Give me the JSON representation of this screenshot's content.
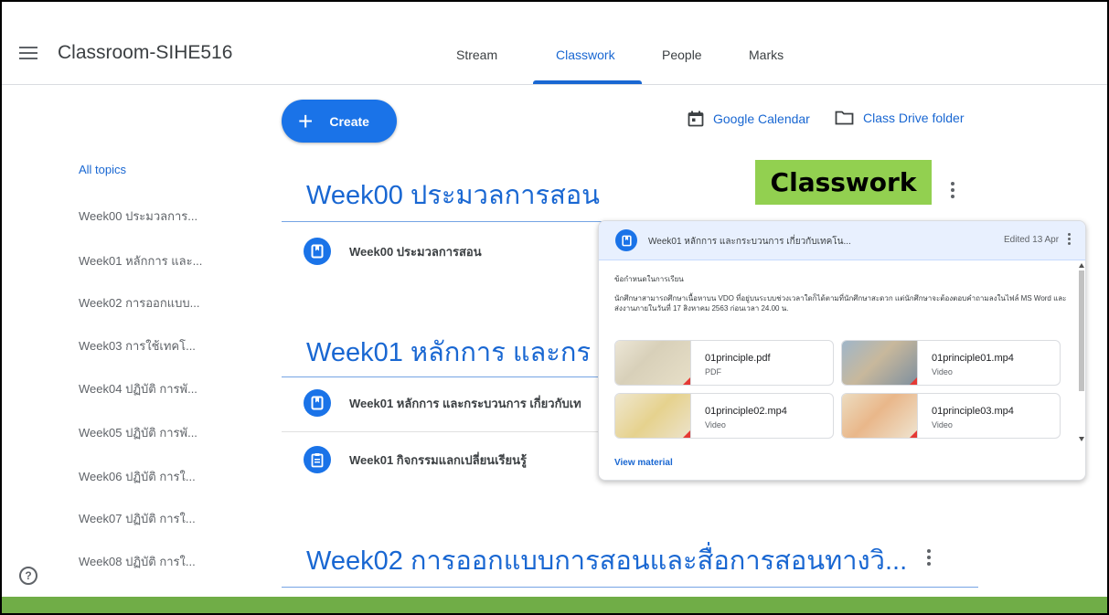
{
  "header": {
    "class_title": "Classroom-SIHE516",
    "tabs": [
      {
        "label": "Stream",
        "active": false
      },
      {
        "label": "Classwork",
        "active": true
      },
      {
        "label": "People",
        "active": false
      },
      {
        "label": "Marks",
        "active": false
      }
    ]
  },
  "toolbar": {
    "create_label": "Create",
    "calendar_label": "Google Calendar",
    "drive_label": "Class Drive folder"
  },
  "sidebar": {
    "topics": [
      {
        "label": "All topics",
        "active": true
      },
      {
        "label": "Week00 ประมวลการ..."
      },
      {
        "label": "Week01 หลักการ และ..."
      },
      {
        "label": "Week02 การออกแบบ..."
      },
      {
        "label": "Week03 การใช้เทคโ..."
      },
      {
        "label": "Week04 ปฏิบัติ การพั..."
      },
      {
        "label": "Week05 ปฏิบัติ การพั..."
      },
      {
        "label": "Week06 ปฏิบัติ การใ..."
      },
      {
        "label": "Week07 ปฏิบัติ การใ..."
      },
      {
        "label": "Week08 ปฏิบัติ การใ..."
      }
    ]
  },
  "sections": [
    {
      "heading": "Week00 ประมวลการสอน",
      "items": [
        "Week00 ประมวลการสอน"
      ]
    },
    {
      "heading": "Week01 หลักการ และกร",
      "items": [
        "Week01 หลักการ และกระบวนการ เกี่ยวกับเท",
        "Week01 กิจกรรมแลกเปลี่ยนเรียนรู้"
      ]
    },
    {
      "heading": "Week02 การออกแบบการสอนและสื่อการสอนทางวิ...",
      "items": []
    }
  ],
  "callout_label": "Classwork",
  "card": {
    "title": "Week01 หลักการ และกระบวนการ เกี่ยวกับเทคโน...",
    "edited": "Edited 13 Apr",
    "body_heading": "ข้อกำหนดในการเรียน",
    "body_text": "นักศึกษาสามารถศึกษาเนื้อหาบน VDO ที่อยู่บนระบบช่วงเวลาใดก็ได้ตามที่นักศึกษาสะดวก แต่นักศึกษาจะต้องตอบคำถามลงในไฟล์ MS Word และส่งงานภายในวันที่ 17 สิงหาคม 2563 ก่อนเวลา 24.00 น.",
    "attachments": [
      {
        "name": "01principle.pdf",
        "type": "PDF"
      },
      {
        "name": "01principle01.mp4",
        "type": "Video"
      },
      {
        "name": "01principle02.mp4",
        "type": "Video"
      },
      {
        "name": "01principle03.mp4",
        "type": "Video"
      }
    ],
    "view_label": "View material"
  },
  "icons": {
    "menu": "menu-icon",
    "help": "help-icon",
    "calendar": "calendar-icon",
    "folder": "folder-icon",
    "material": "material-bookmark-icon",
    "assignment": "assignment-icon",
    "more": "more-vert-icon"
  },
  "colors": {
    "accent": "#1967d2",
    "button": "#1a73e8",
    "callout": "#92d050",
    "bottom_bar": "#70ad47"
  }
}
